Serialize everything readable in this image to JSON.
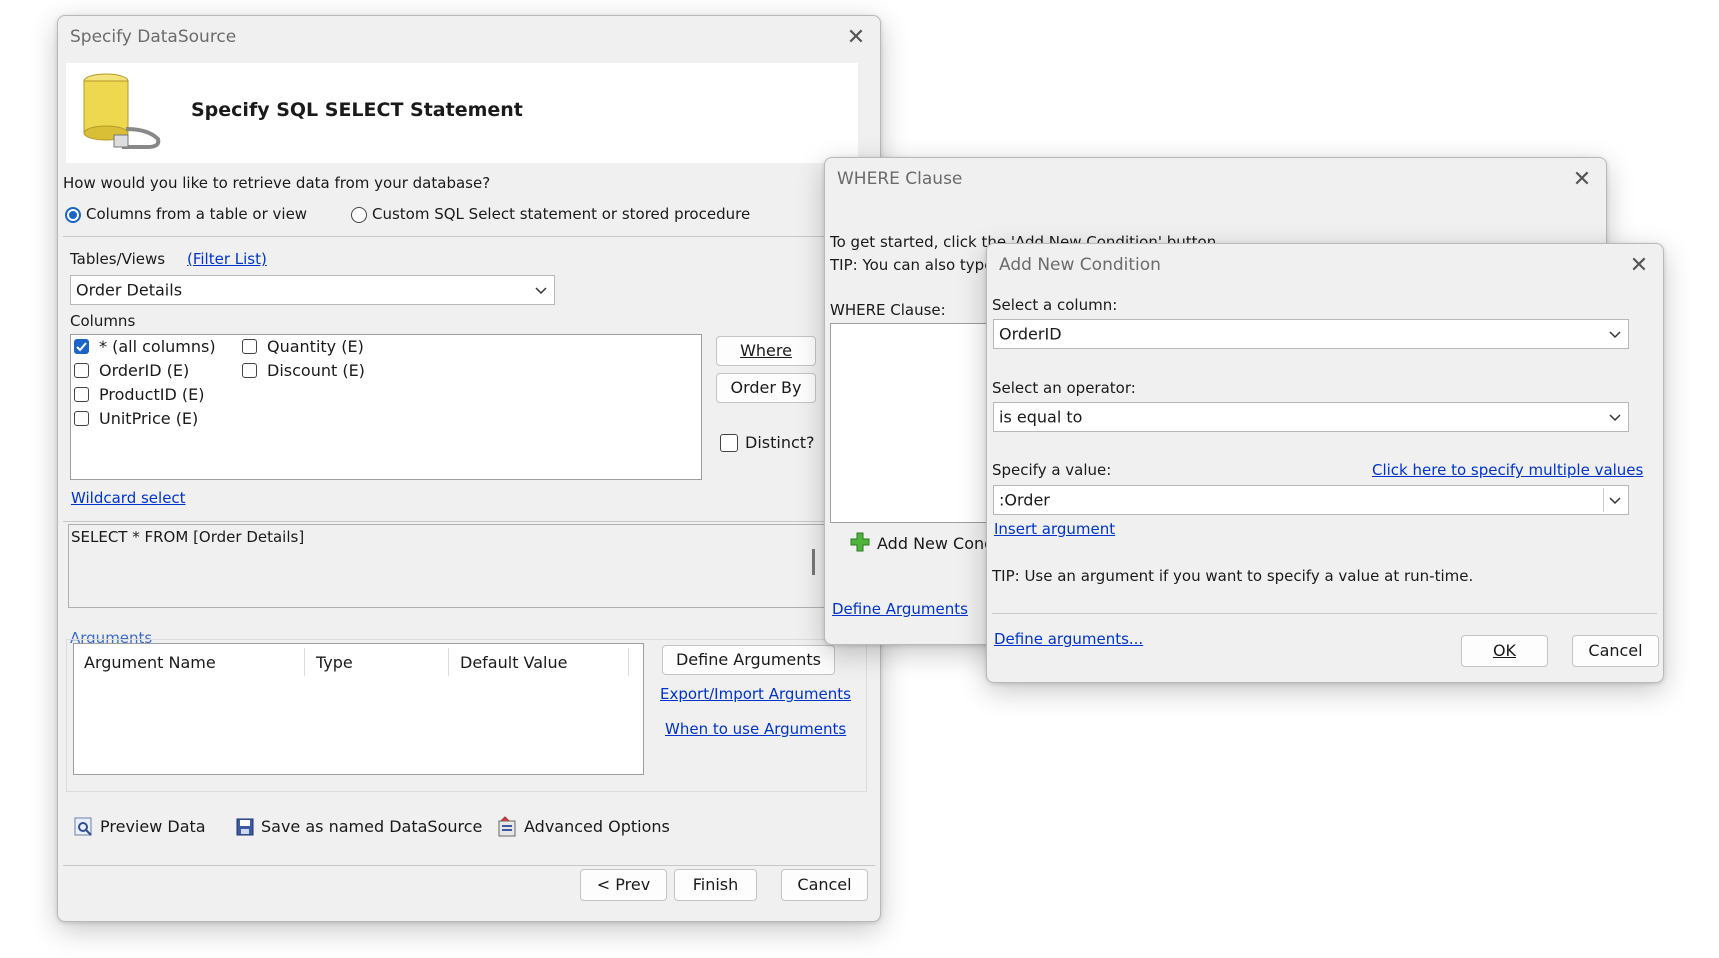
{
  "specify_ds": {
    "title": "Specify DataSource",
    "header_title": "Specify SQL SELECT Statement",
    "question": "How would you like to retrieve data from your database?",
    "radio_columns": "Columns from a table or view",
    "radio_custom": "Custom SQL Select statement or stored procedure",
    "tables_label": "Tables/Views",
    "filter_list": "(Filter List)",
    "table_selected": "Order Details",
    "columns_label": "Columns",
    "columns": [
      "* (all columns)",
      "OrderID (E)",
      "ProductID (E)",
      "UnitPrice (E)",
      "Quantity (E)",
      "Discount (E)"
    ],
    "where_btn": "Where",
    "orderby_btn": "Order By",
    "distinct_label": "Distinct?",
    "wildcard_select": "Wildcard select",
    "sql_text": "SELECT * FROM [Order Details]",
    "arguments_label": "Arguments",
    "arg_headers": [
      "Argument Name",
      "Type",
      "Default Value"
    ],
    "define_arguments_btn": "Define Arguments",
    "export_import_link": "Export/Import Arguments",
    "when_to_use_link": "When to use Arguments",
    "preview_data": "Preview Data",
    "save_named": "Save as named DataSource",
    "advanced_options": "Advanced Options",
    "prev_btn": "< Prev",
    "finish_btn": "Finish",
    "cancel_btn": "Cancel"
  },
  "where_clause": {
    "title": "WHERE Clause",
    "intro": "To get started, click the 'Add New Condition' button.",
    "tip": "TIP: You can also type",
    "where_label": "WHERE Clause:",
    "add_condition": "Add New Condi",
    "define_arguments_link": "Define Arguments"
  },
  "add_condition": {
    "title": "Add New Condition",
    "select_column_label": "Select a column:",
    "column_value": "OrderID",
    "operator_label": "Select an operator:",
    "operator_value": "is equal to",
    "value_label": "Specify a value:",
    "multiple_values_link": "Click here to specify multiple values",
    "value": ":Order",
    "insert_argument_link": "Insert argument",
    "tip": "TIP: Use an argument if you want to specify a value at run-time.",
    "define_arguments_link": "Define arguments...",
    "ok_btn": "OK",
    "cancel_btn": "Cancel"
  },
  "colors": {
    "accent": "#1a64c8",
    "link": "#0033cc",
    "window_bg": "#f0f0f0"
  }
}
